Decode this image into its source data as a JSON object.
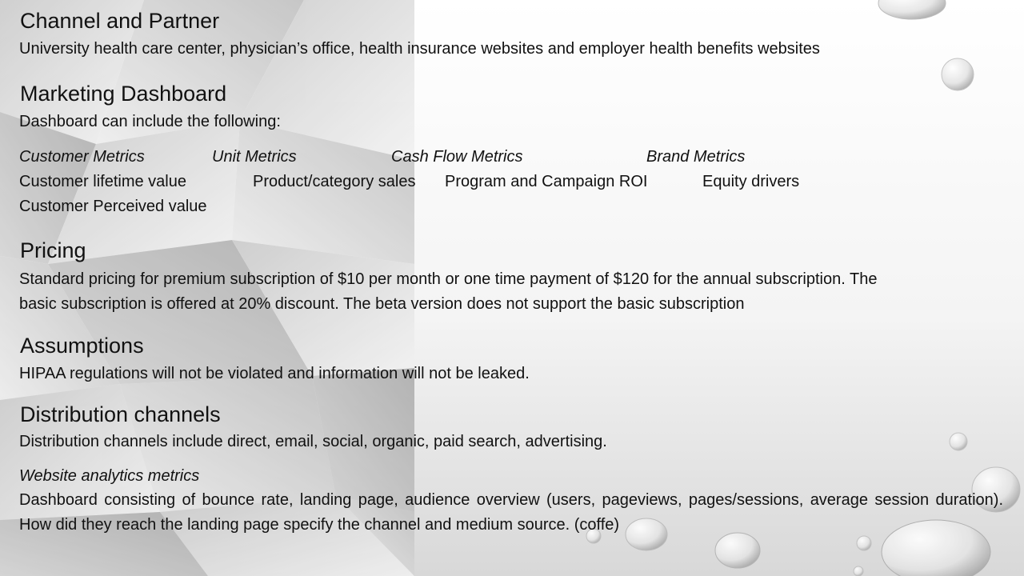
{
  "sections": {
    "channel": {
      "heading": "Channel and Partner",
      "text": "University health care center, physician’s office, health insurance websites and employer health benefits websites"
    },
    "dashboard": {
      "heading": "Marketing Dashboard",
      "intro": "Dashboard can include the following:",
      "columns": [
        {
          "title": "Customer Metrics",
          "items": [
            "Customer lifetime value",
            "Customer Perceived value"
          ]
        },
        {
          "title": "Unit Metrics",
          "items": [
            "Product/category sales"
          ]
        },
        {
          "title": "Cash Flow Metrics",
          "items": [
            "Program and Campaign ROI"
          ]
        },
        {
          "title": "Brand Metrics",
          "items": [
            "Equity drivers"
          ]
        }
      ]
    },
    "pricing": {
      "heading": "Pricing",
      "line1": "Standard pricing for premium subscription of $10 per month or one time payment of $120 for the annual subscription. The",
      "line2": "basic subscription is offered at 20% discount.  The beta version does not support the basic subscription"
    },
    "assumptions": {
      "heading": "Assumptions",
      "text": "HIPAA regulations will not be violated and information will not be leaked."
    },
    "distribution": {
      "heading": "Distribution channels",
      "text": "Distribution channels include direct, email, social, organic, paid search, advertising."
    },
    "analytics": {
      "subheading": "Website analytics metrics",
      "text": "Dashboard consisting of bounce rate, landing page, audience overview (users, pageviews, pages/sessions, average session duration). How did they reach the landing page specify the channel and medium source.  (coffe)"
    }
  }
}
